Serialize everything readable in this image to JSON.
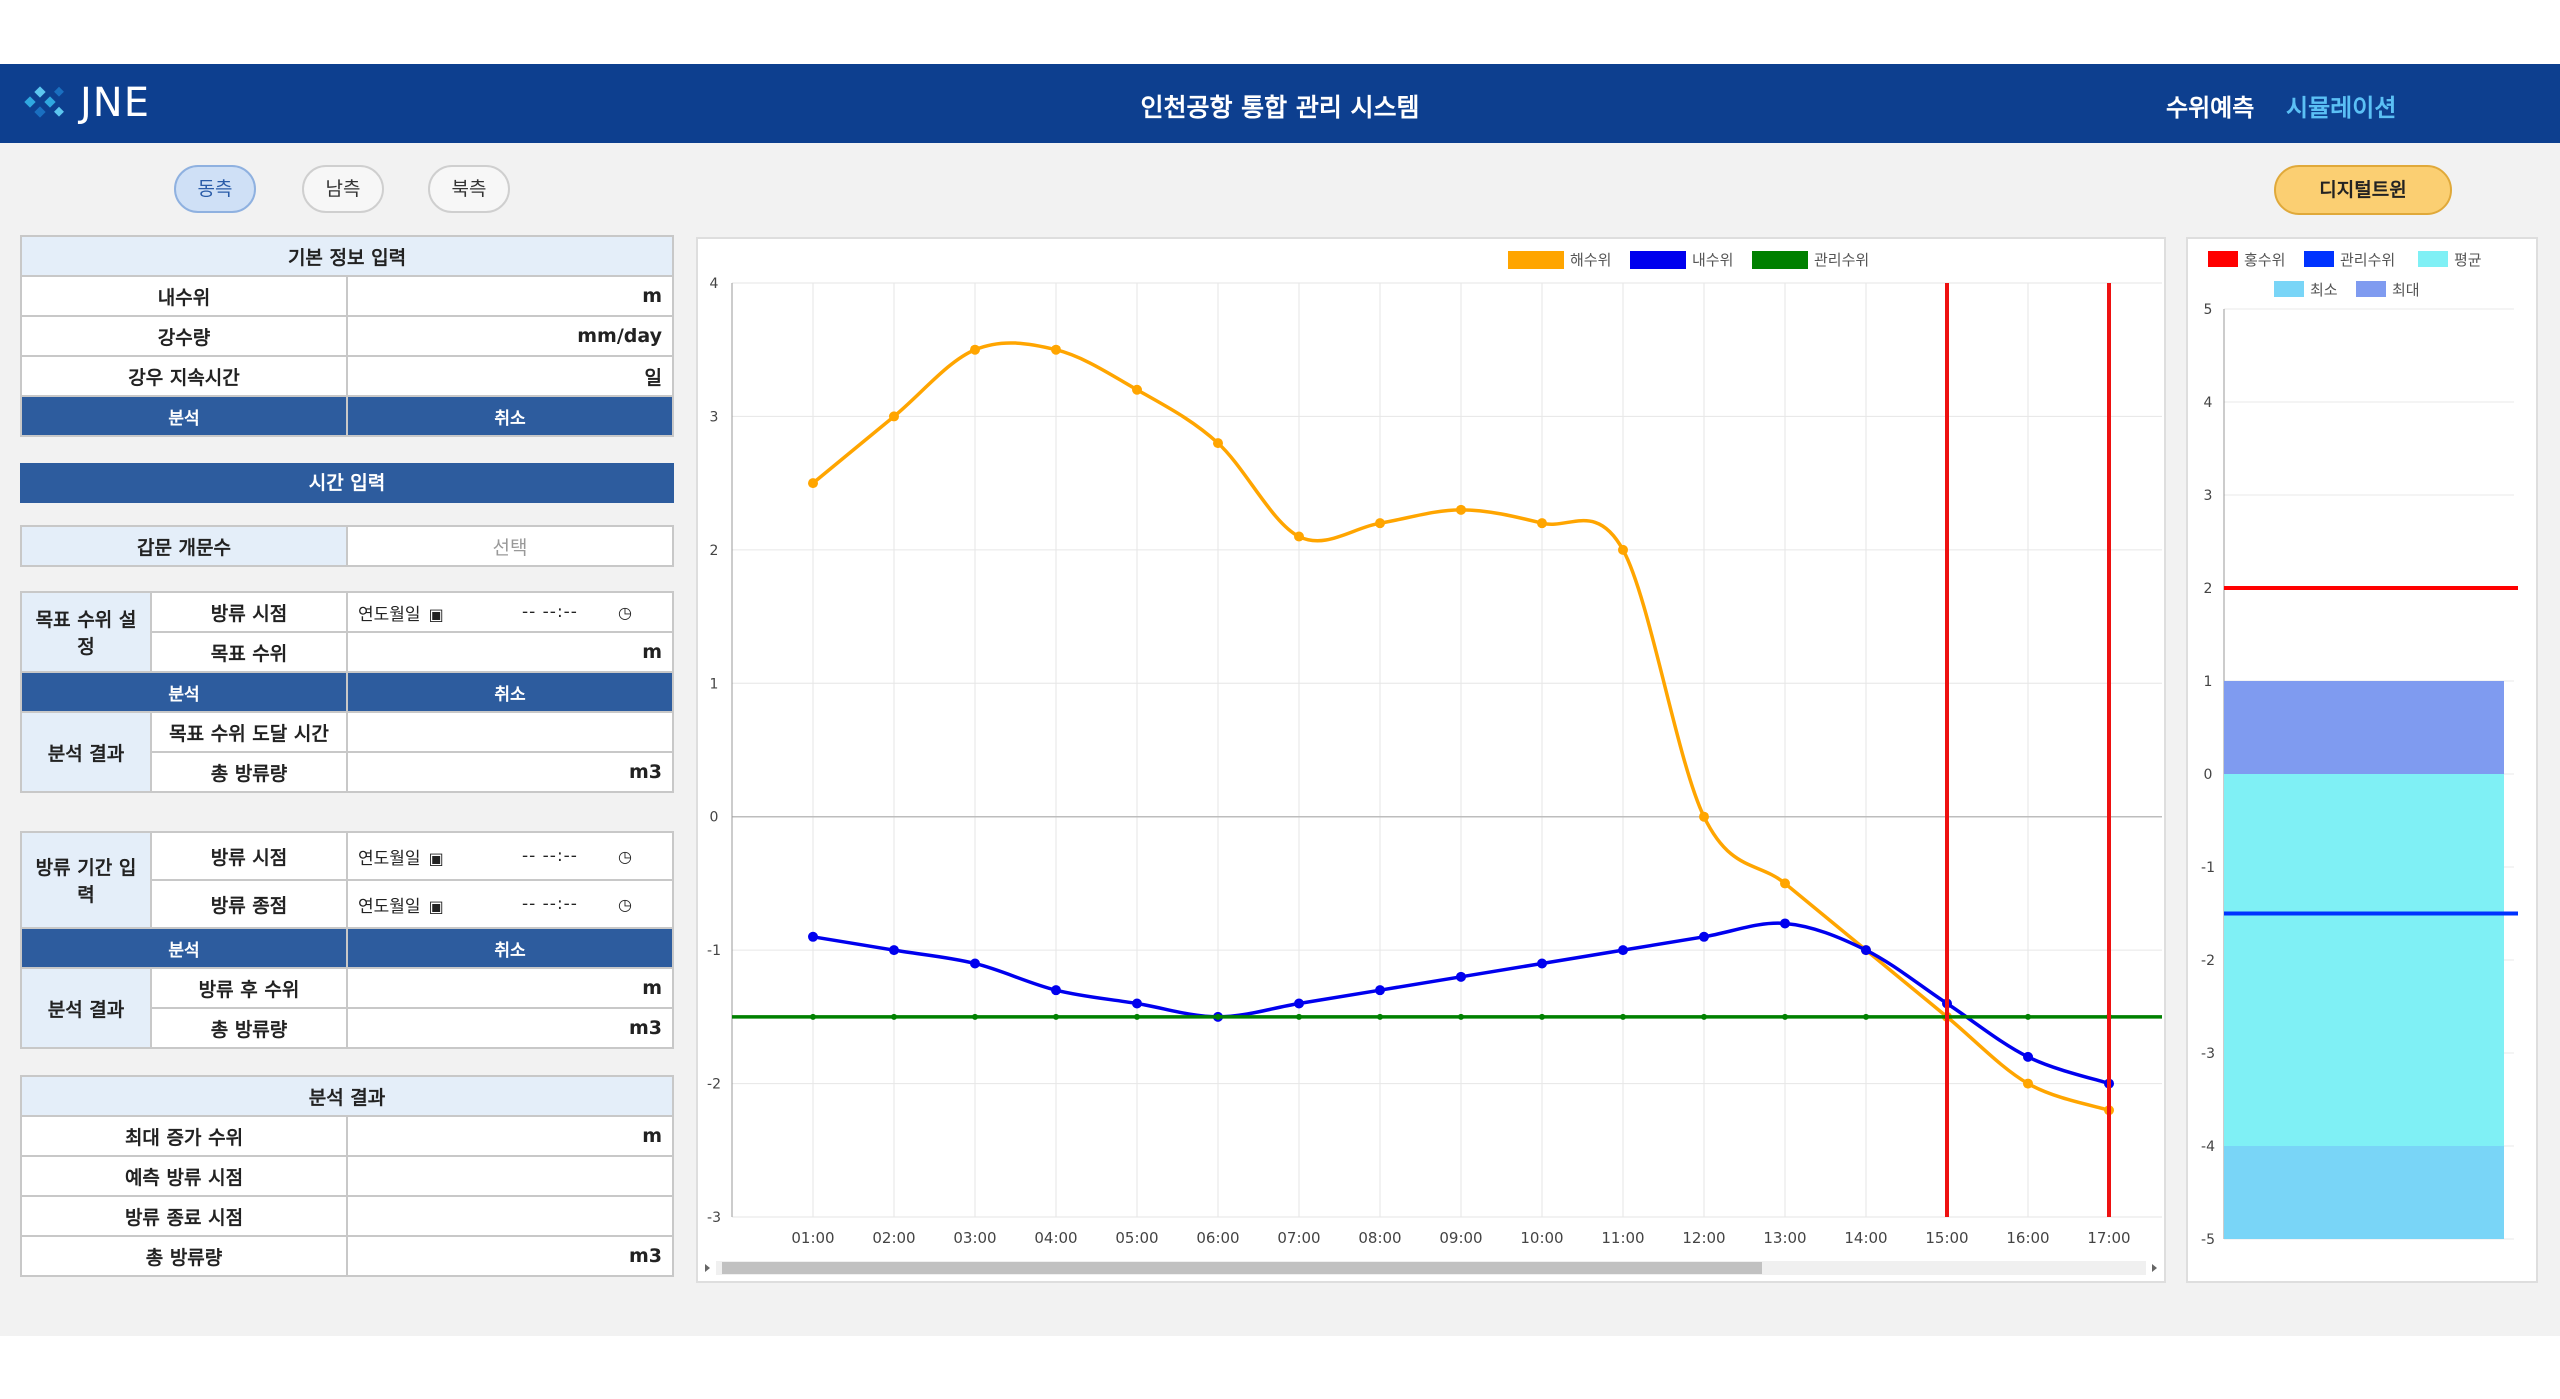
{
  "header": {
    "logo_text": "JNE",
    "title": "인천공항 통합 관리 시스템",
    "nav": {
      "forecast": "수위예측",
      "simulation": "시뮬레이션"
    },
    "colors": {
      "bar": "#0d3f8f",
      "active_nav": "#5bc0f5"
    }
  },
  "sides": {
    "east": "동측",
    "south": "남측",
    "north": "북측",
    "active": "동측"
  },
  "digital_twin_label": "디지털트윈",
  "basic_info": {
    "title": "기본 정보 입력",
    "rows": [
      {
        "label": "내수위",
        "unit": "m"
      },
      {
        "label": "강수량",
        "unit": "mm/day"
      },
      {
        "label": "강우 지속시간",
        "unit": "일"
      }
    ],
    "analyze": "분석",
    "cancel": "취소"
  },
  "time_input_title": "시간 입력",
  "gate": {
    "label": "갑문 개문수",
    "placeholder": "선택"
  },
  "target": {
    "group": "목표 수위 설정",
    "start_label": "방류 시점",
    "target_label": "목표 수위",
    "target_unit": "m",
    "analyze": "분석",
    "cancel": "취소",
    "result_group": "분석 결과",
    "reach_time_label": "목표 수위 도달 시간",
    "total_label": "총 방류량",
    "total_unit": "m3"
  },
  "datetime": {
    "date_placeholder": "연도월일",
    "time_placeholder": "-- --:--"
  },
  "period": {
    "group": "방류 기간 입력",
    "start_label": "방류 시점",
    "end_label": "방류 종점",
    "analyze": "분석",
    "cancel": "취소",
    "result_group": "분석 결과",
    "after_level_label": "방류 후 수위",
    "after_level_unit": "m",
    "total_label": "총 방류량",
    "total_unit": "m3"
  },
  "final_result": {
    "title": "분석 결과",
    "rows": [
      {
        "label": "최대 증가 수위",
        "unit": "m"
      },
      {
        "label": "예측 방류 시점",
        "unit": ""
      },
      {
        "label": "방류 종료 시점",
        "unit": ""
      },
      {
        "label": "총 방류량",
        "unit": "m3"
      }
    ]
  },
  "chart_data": [
    {
      "type": "line",
      "x": [
        "01:00",
        "02:00",
        "03:00",
        "04:00",
        "05:00",
        "06:00",
        "07:00",
        "08:00",
        "09:00",
        "10:00",
        "11:00",
        "12:00",
        "13:00",
        "14:00",
        "15:00",
        "16:00",
        "17:00"
      ],
      "series": [
        {
          "name": "해수위",
          "color": "#ffa500",
          "values": [
            2.5,
            3.0,
            3.5,
            3.5,
            3.2,
            2.8,
            2.1,
            2.2,
            2.3,
            2.2,
            2.0,
            0.0,
            -0.5,
            -1.0,
            -1.5,
            -2.0,
            -2.2
          ]
        },
        {
          "name": "내수위",
          "color": "#0000ee",
          "values": [
            -0.9,
            -1.0,
            -1.1,
            -1.3,
            -1.4,
            -1.5,
            -1.4,
            -1.3,
            -1.2,
            -1.1,
            -1.0,
            -0.9,
            -0.8,
            -1.0,
            -1.4,
            -1.8,
            -2.0
          ]
        },
        {
          "name": "관리수위",
          "color": "#008000",
          "values": [
            -1.5,
            -1.5,
            -1.5,
            -1.5,
            -1.5,
            -1.5,
            -1.5,
            -1.5,
            -1.5,
            -1.5,
            -1.5,
            -1.5,
            -1.5,
            -1.5,
            -1.5,
            -1.5,
            -1.5
          ]
        }
      ],
      "vertical_markers": [
        "15:00",
        "17:00"
      ],
      "marker_color": "#ee1111",
      "yticks": [
        "4",
        "3",
        "2",
        "1",
        "0",
        "-1",
        "-2",
        "-3"
      ],
      "ylim": [
        -3,
        4
      ],
      "grid": true,
      "legend": "top-center",
      "horizontal_scrollbar": true
    },
    {
      "type": "bar",
      "legend": [
        {
          "name": "홍수위",
          "color": "#ff0000"
        },
        {
          "name": "관리수위",
          "color": "#0033ff"
        },
        {
          "name": "평균",
          "color": "#7ff0f5"
        },
        {
          "name": "최소",
          "color": "#79d5f7"
        },
        {
          "name": "최대",
          "color": "#7f9bf0"
        }
      ],
      "flood_level": 2,
      "management_level": -1.5,
      "bands": {
        "max": [
          0,
          1
        ],
        "average": [
          -4,
          0
        ],
        "min": [
          -5,
          -4
        ]
      },
      "yticks": [
        "5",
        "4",
        "3",
        "2",
        "1",
        "0",
        "-1",
        "-2",
        "-3",
        "-4",
        "-5"
      ],
      "ylim": [
        -5,
        5
      ],
      "legend_position": "top"
    }
  ]
}
